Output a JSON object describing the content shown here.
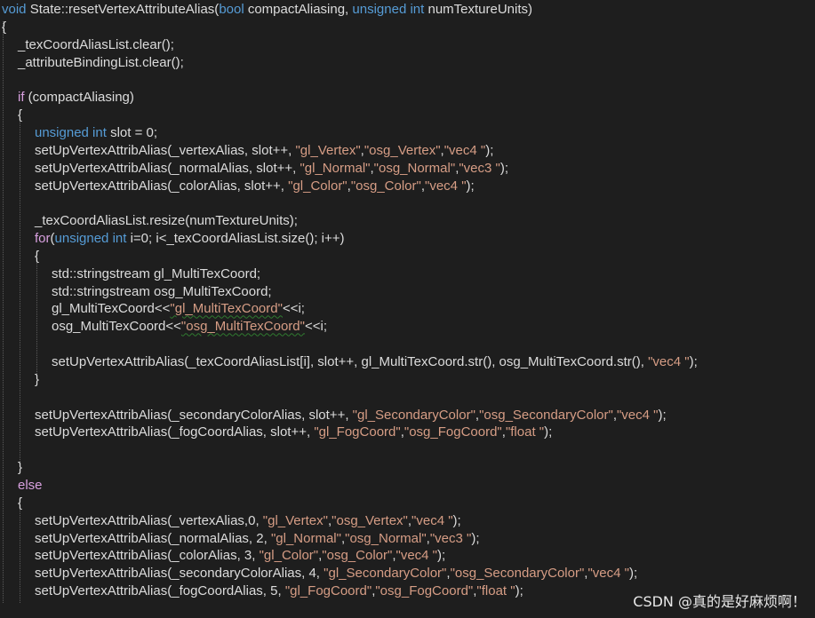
{
  "colors": {
    "background": "#1e1e1e",
    "text": "#dcdcdc",
    "keyword": "#569cd6",
    "control": "#d8a0df",
    "string": "#d69d85",
    "guide": "#5a5a5a"
  },
  "watermark": "CSDN @真的是好麻烦啊！",
  "code": {
    "lines": [
      {
        "indent": 0,
        "tokens": [
          [
            "k",
            "void"
          ],
          [
            "t",
            " State::resetVertexAttributeAlias("
          ],
          [
            "k",
            "bool"
          ],
          [
            "t",
            " compactAliasing, "
          ],
          [
            "k",
            "unsigned int"
          ],
          [
            "t",
            " numTextureUnits)"
          ]
        ]
      },
      {
        "indent": 0,
        "tokens": [
          [
            "t",
            "{"
          ]
        ]
      },
      {
        "indent": 1,
        "tokens": [
          [
            "t",
            "_texCoordAliasList.clear();"
          ]
        ]
      },
      {
        "indent": 1,
        "tokens": [
          [
            "t",
            "_attributeBindingList.clear();"
          ]
        ]
      },
      {
        "indent": 1,
        "tokens": []
      },
      {
        "indent": 1,
        "tokens": [
          [
            "c",
            "if"
          ],
          [
            "t",
            " (compactAliasing)"
          ]
        ]
      },
      {
        "indent": 1,
        "tokens": [
          [
            "t",
            "{"
          ]
        ]
      },
      {
        "indent": 2,
        "tokens": [
          [
            "k",
            "unsigned int"
          ],
          [
            "t",
            " slot = 0;"
          ]
        ]
      },
      {
        "indent": 2,
        "tokens": [
          [
            "t",
            "setUpVertexAttribAlias(_vertexAlias, slot++, "
          ],
          [
            "s",
            "\"gl_Vertex\""
          ],
          [
            "t",
            ","
          ],
          [
            "s",
            "\"osg_Vertex\""
          ],
          [
            "t",
            ","
          ],
          [
            "s",
            "\"vec4 \""
          ],
          [
            "t",
            ");"
          ]
        ]
      },
      {
        "indent": 2,
        "tokens": [
          [
            "t",
            "setUpVertexAttribAlias(_normalAlias, slot++, "
          ],
          [
            "s",
            "\"gl_Normal\""
          ],
          [
            "t",
            ","
          ],
          [
            "s",
            "\"osg_Normal\""
          ],
          [
            "t",
            ","
          ],
          [
            "s",
            "\"vec3 \""
          ],
          [
            "t",
            ");"
          ]
        ]
      },
      {
        "indent": 2,
        "tokens": [
          [
            "t",
            "setUpVertexAttribAlias(_colorAlias, slot++, "
          ],
          [
            "s",
            "\"gl_Color\""
          ],
          [
            "t",
            ","
          ],
          [
            "s",
            "\"osg_Color\""
          ],
          [
            "t",
            ","
          ],
          [
            "s",
            "\"vec4 \""
          ],
          [
            "t",
            ");"
          ]
        ]
      },
      {
        "indent": 2,
        "tokens": []
      },
      {
        "indent": 2,
        "tokens": [
          [
            "t",
            "_texCoordAliasList.resize(numTextureUnits);"
          ]
        ]
      },
      {
        "indent": 2,
        "tokens": [
          [
            "c",
            "for"
          ],
          [
            "t",
            "("
          ],
          [
            "k",
            "unsigned int"
          ],
          [
            "t",
            " i=0; i<_texCoordAliasList.size(); i++)"
          ]
        ]
      },
      {
        "indent": 2,
        "tokens": [
          [
            "t",
            "{"
          ]
        ]
      },
      {
        "indent": 3,
        "tokens": [
          [
            "t",
            "std::stringstream gl_MultiTexCoord;"
          ]
        ]
      },
      {
        "indent": 3,
        "tokens": [
          [
            "t",
            "std::stringstream osg_MultiTexCoord;"
          ]
        ]
      },
      {
        "indent": 3,
        "tokens": [
          [
            "t",
            "gl_MultiTexCoord<<"
          ],
          [
            "s",
            "\"gl_MultiTexCoord\""
          ],
          [
            "t",
            "<<i;"
          ]
        ]
      },
      {
        "indent": 3,
        "tokens": [
          [
            "t",
            "osg_MultiTexCoord<<"
          ],
          [
            "s",
            "\"osg_MultiTexCoord\""
          ],
          [
            "t",
            "<<i;"
          ]
        ]
      },
      {
        "indent": 3,
        "tokens": []
      },
      {
        "indent": 3,
        "tokens": [
          [
            "t",
            "setUpVertexAttribAlias(_texCoordAliasList[i], slot++, gl_MultiTexCoord.str(), osg_MultiTexCoord.str(), "
          ],
          [
            "s",
            "\"vec4 \""
          ],
          [
            "t",
            ");"
          ]
        ]
      },
      {
        "indent": 2,
        "tokens": [
          [
            "t",
            "}"
          ]
        ]
      },
      {
        "indent": 2,
        "tokens": []
      },
      {
        "indent": 2,
        "tokens": [
          [
            "t",
            "setUpVertexAttribAlias(_secondaryColorAlias, slot++, "
          ],
          [
            "s",
            "\"gl_SecondaryColor\""
          ],
          [
            "t",
            ","
          ],
          [
            "s",
            "\"osg_SecondaryColor\""
          ],
          [
            "t",
            ","
          ],
          [
            "s",
            "\"vec4 \""
          ],
          [
            "t",
            ");"
          ]
        ]
      },
      {
        "indent": 2,
        "tokens": [
          [
            "t",
            "setUpVertexAttribAlias(_fogCoordAlias, slot++, "
          ],
          [
            "s",
            "\"gl_FogCoord\""
          ],
          [
            "t",
            ","
          ],
          [
            "s",
            "\"osg_FogCoord\""
          ],
          [
            "t",
            ","
          ],
          [
            "s",
            "\"float \""
          ],
          [
            "t",
            ");"
          ]
        ]
      },
      {
        "indent": 2,
        "tokens": []
      },
      {
        "indent": 1,
        "tokens": [
          [
            "t",
            "}"
          ]
        ]
      },
      {
        "indent": 1,
        "tokens": [
          [
            "c",
            "else"
          ]
        ]
      },
      {
        "indent": 1,
        "tokens": [
          [
            "t",
            "{"
          ]
        ]
      },
      {
        "indent": 2,
        "tokens": [
          [
            "t",
            "setUpVertexAttribAlias(_vertexAlias,0, "
          ],
          [
            "s",
            "\"gl_Vertex\""
          ],
          [
            "t",
            ","
          ],
          [
            "s",
            "\"osg_Vertex\""
          ],
          [
            "t",
            ","
          ],
          [
            "s",
            "\"vec4 \""
          ],
          [
            "t",
            ");"
          ]
        ]
      },
      {
        "indent": 2,
        "tokens": [
          [
            "t",
            "setUpVertexAttribAlias(_normalAlias, 2, "
          ],
          [
            "s",
            "\"gl_Normal\""
          ],
          [
            "t",
            ","
          ],
          [
            "s",
            "\"osg_Normal\""
          ],
          [
            "t",
            ","
          ],
          [
            "s",
            "\"vec3 \""
          ],
          [
            "t",
            ");"
          ]
        ]
      },
      {
        "indent": 2,
        "tokens": [
          [
            "t",
            "setUpVertexAttribAlias(_colorAlias, 3, "
          ],
          [
            "s",
            "\"gl_Color\""
          ],
          [
            "t",
            ","
          ],
          [
            "s",
            "\"osg_Color\""
          ],
          [
            "t",
            ","
          ],
          [
            "s",
            "\"vec4 \""
          ],
          [
            "t",
            ");"
          ]
        ]
      },
      {
        "indent": 2,
        "tokens": [
          [
            "t",
            "setUpVertexAttribAlias(_secondaryColorAlias, 4, "
          ],
          [
            "s",
            "\"gl_SecondaryColor\""
          ],
          [
            "t",
            ","
          ],
          [
            "s",
            "\"osg_SecondaryColor\""
          ],
          [
            "t",
            ","
          ],
          [
            "s",
            "\"vec4 \""
          ],
          [
            "t",
            ");"
          ]
        ]
      },
      {
        "indent": 2,
        "tokens": [
          [
            "t",
            "setUpVertexAttribAlias(_fogCoordAlias, 5, "
          ],
          [
            "s",
            "\"gl_FogCoord\""
          ],
          [
            "t",
            ","
          ],
          [
            "s",
            "\"osg_FogCoord\""
          ],
          [
            "t",
            ","
          ],
          [
            "s",
            "\"float \""
          ],
          [
            "t",
            ");"
          ]
        ]
      }
    ]
  }
}
